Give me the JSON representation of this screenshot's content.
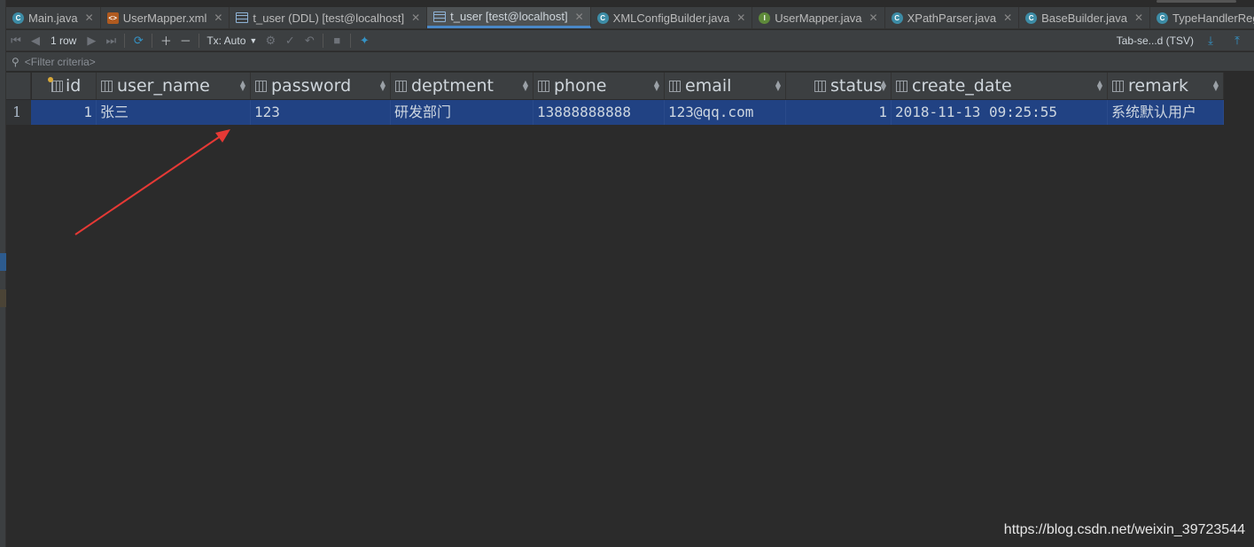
{
  "tabs": [
    {
      "label": "Main.java",
      "icon": "java-class-icon",
      "active": false
    },
    {
      "label": "UserMapper.xml",
      "icon": "xml-file-icon",
      "active": false
    },
    {
      "label": "t_user (DDL) [test@localhost]",
      "icon": "table-icon",
      "active": false
    },
    {
      "label": "t_user [test@localhost]",
      "icon": "table-icon",
      "active": true
    },
    {
      "label": "XMLConfigBuilder.java",
      "icon": "java-class-icon",
      "active": false
    },
    {
      "label": "UserMapper.java",
      "icon": "java-interface-icon",
      "active": false
    },
    {
      "label": "XPathParser.java",
      "icon": "java-class-icon",
      "active": false
    },
    {
      "label": "BaseBuilder.java",
      "icon": "java-class-icon",
      "active": false
    },
    {
      "label": "TypeHandlerRegist",
      "icon": "java-class-icon",
      "active": false
    }
  ],
  "toolbar": {
    "row_count": "1 row",
    "tx_mode": "Tx: Auto",
    "export_format": "Tab-se...d (TSV)"
  },
  "filter": {
    "placeholder": "<Filter criteria>"
  },
  "grid": {
    "columns": [
      {
        "name": "id",
        "key": true
      },
      {
        "name": "user_name"
      },
      {
        "name": "password"
      },
      {
        "name": "deptment"
      },
      {
        "name": "phone"
      },
      {
        "name": "email"
      },
      {
        "name": "status"
      },
      {
        "name": "create_date"
      },
      {
        "name": "remark"
      }
    ],
    "rows": [
      {
        "row_number": "1",
        "id": "1",
        "user_name": "张三",
        "password": "123",
        "deptment": "研发部门",
        "phone": "13888888888",
        "email": "123@qq.com",
        "status": "1",
        "create_date": "2018-11-13 09:25:55",
        "remark": "系统默认用户"
      }
    ]
  },
  "watermark": "https://blog.csdn.net/weixin_39723544",
  "colors": {
    "background": "#2b2b2b",
    "selection": "#214283",
    "active_tab_underline": "#4a88c7",
    "annotation_arrow": "#e53935"
  }
}
